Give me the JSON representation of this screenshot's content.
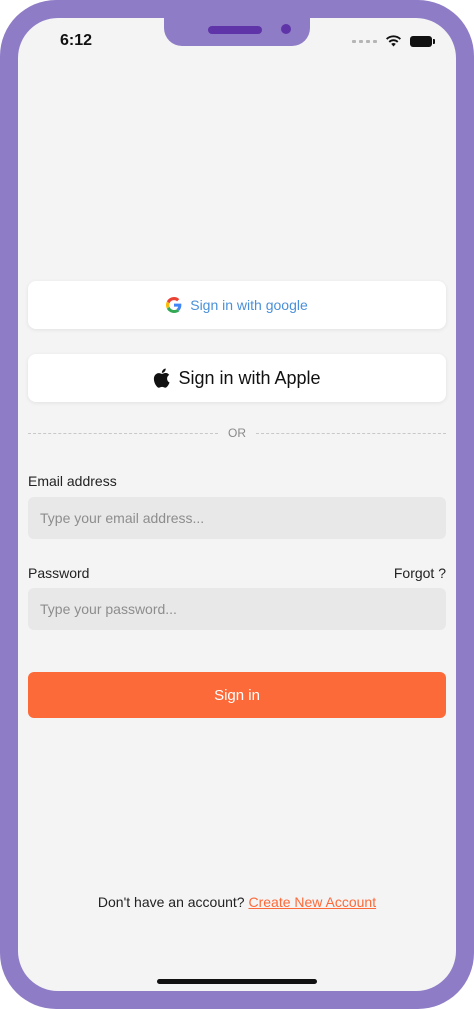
{
  "status_bar": {
    "time": "6:12"
  },
  "social": {
    "google_label": "Sign in with google",
    "google_icon": "google-g-icon",
    "apple_label": "Sign in with Apple",
    "apple_icon": "apple-logo-icon"
  },
  "divider": {
    "text": "OR"
  },
  "form": {
    "email_label": "Email address",
    "email_placeholder": "Type your email address...",
    "email_value": "",
    "password_label": "Password",
    "password_placeholder": "Type your password...",
    "password_value": "",
    "forgot_label": "Forgot ?",
    "submit_label": "Sign in"
  },
  "footer": {
    "prompt": "Don't have an account?",
    "create_link": "Create New Account"
  },
  "colors": {
    "frame": "#8f7cc6",
    "accent": "#fd6a39",
    "google_text": "#4a90d9",
    "background": "#f4f4f5",
    "input_bg": "#e8e8e8"
  }
}
